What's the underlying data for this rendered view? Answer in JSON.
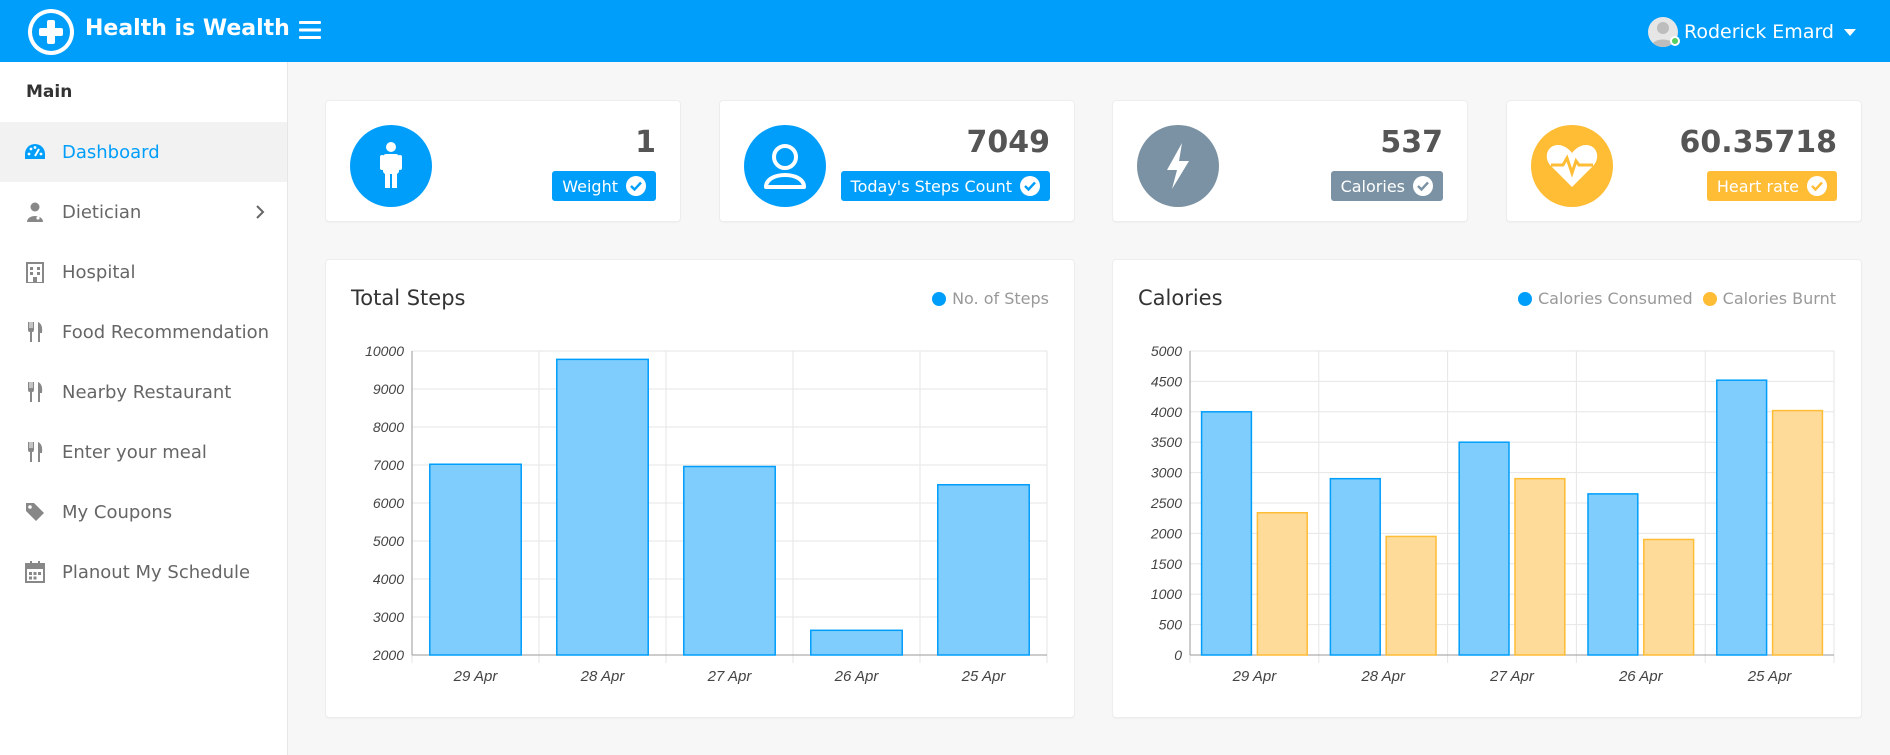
{
  "header": {
    "brand": "Health is Wealth",
    "user_name": "Roderick Emard"
  },
  "sidebar": {
    "section_title": "Main",
    "items": [
      {
        "label": "Dashboard",
        "icon": "dashboard-icon",
        "active": true
      },
      {
        "label": "Dietician",
        "icon": "user-doctor-icon",
        "has_submenu": true
      },
      {
        "label": "Hospital",
        "icon": "hospital-icon"
      },
      {
        "label": "Food Recommendation",
        "icon": "cutlery-icon"
      },
      {
        "label": "Nearby Restaurant",
        "icon": "cutlery-icon"
      },
      {
        "label": "Enter your meal",
        "icon": "cutlery-icon"
      },
      {
        "label": "My Coupons",
        "icon": "tag-icon"
      },
      {
        "label": "Planout My Schedule",
        "icon": "calendar-icon"
      }
    ]
  },
  "stats": [
    {
      "value": "1",
      "label": "Weight",
      "icon": "person-icon",
      "color": "#009efb"
    },
    {
      "value": "7049",
      "label": "Today's Steps Count",
      "icon": "user-icon",
      "color": "#009efb"
    },
    {
      "value": "537",
      "label": "Calories",
      "icon": "bolt-icon",
      "color": "#7a92a3"
    },
    {
      "value": "60.35718",
      "label": "Heart rate",
      "icon": "heartbeat-icon",
      "color": "#ffbc35"
    }
  ],
  "colors": {
    "primary": "#009efb",
    "bar_blue_fill": "#7fcdfd",
    "bar_orange_fill": "#ffdb9a",
    "bar_orange_stroke": "#ffbc35",
    "calories_gray": "#7a92a3",
    "heart_orange": "#ffbc35"
  },
  "chart_data": [
    {
      "type": "bar",
      "title": "Total Steps",
      "categories": [
        "29 Apr",
        "28 Apr",
        "27 Apr",
        "26 Apr",
        "25 Apr"
      ],
      "series": [
        {
          "name": "No. of Steps",
          "values": [
            7020,
            9780,
            6960,
            2650,
            6480
          ],
          "color": "#009efb"
        }
      ],
      "ylim": [
        2000,
        10000
      ],
      "yticks": [
        2000,
        3000,
        4000,
        5000,
        6000,
        7000,
        8000,
        9000,
        10000
      ],
      "legend": "top-right",
      "grid": true
    },
    {
      "type": "bar",
      "title": "Calories",
      "categories": [
        "29 Apr",
        "28 Apr",
        "27 Apr",
        "26 Apr",
        "25 Apr"
      ],
      "series": [
        {
          "name": "Calories Consumed",
          "values": [
            4000,
            2900,
            3500,
            2650,
            4520
          ],
          "color": "#009efb"
        },
        {
          "name": "Calories Burnt",
          "values": [
            2340,
            1950,
            2900,
            1900,
            4020
          ],
          "color": "#ffbc35"
        }
      ],
      "ylim": [
        0,
        5000
      ],
      "yticks": [
        0,
        500,
        1000,
        1500,
        2000,
        2500,
        3000,
        3500,
        4000,
        4500,
        5000
      ],
      "legend": "top-right",
      "grid": true
    }
  ]
}
